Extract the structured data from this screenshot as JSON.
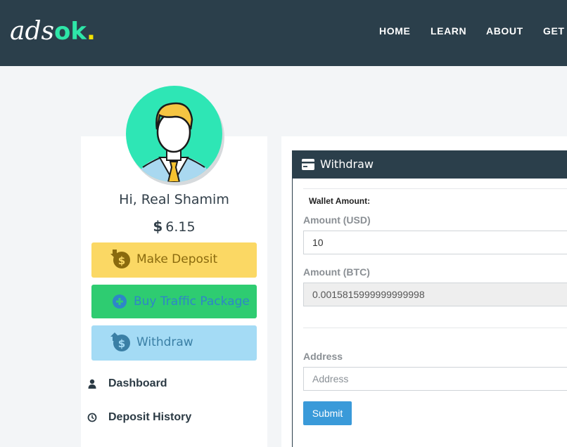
{
  "brand": {
    "logo_main": "ads",
    "logo_accent": "ok",
    "logo_dot": "."
  },
  "nav": {
    "items": [
      "HOME",
      "LEARN",
      "ABOUT",
      "GET"
    ]
  },
  "profile": {
    "greeting": "Hi, Real Shamim",
    "currency_symbol": "$",
    "balance": "6.15"
  },
  "sidebar": {
    "buttons": [
      {
        "label": "Make Deposit",
        "icon": "deposit-dollar-icon"
      },
      {
        "label": "Buy Traffic Package",
        "icon": "plus-circle-icon"
      },
      {
        "label": "Withdraw",
        "icon": "withdraw-dollar-icon"
      }
    ],
    "menu": [
      {
        "label": "Dashboard",
        "icon": "user-icon"
      },
      {
        "label": "Deposit History",
        "icon": "clock-icon"
      }
    ]
  },
  "withdraw": {
    "title": "Withdraw",
    "icon": "credit-card-icon",
    "wallet_label": "Wallet Amount:",
    "usd_label": "Amount (USD)",
    "usd_value": "10",
    "btc_label": "Amount (BTC)",
    "btc_value": "0.0015815999999999998",
    "address_label": "Address",
    "address_placeholder": "Address",
    "submit_label": "Submit"
  },
  "colors": {
    "header_bg": "#2b3f4b",
    "logo_accent": "#2ee6a8",
    "deposit_btn": "#fbd864",
    "traffic_btn": "#2ecc71",
    "withdraw_btn": "#a4dbf5",
    "submit_btn": "#3a9ad9"
  }
}
